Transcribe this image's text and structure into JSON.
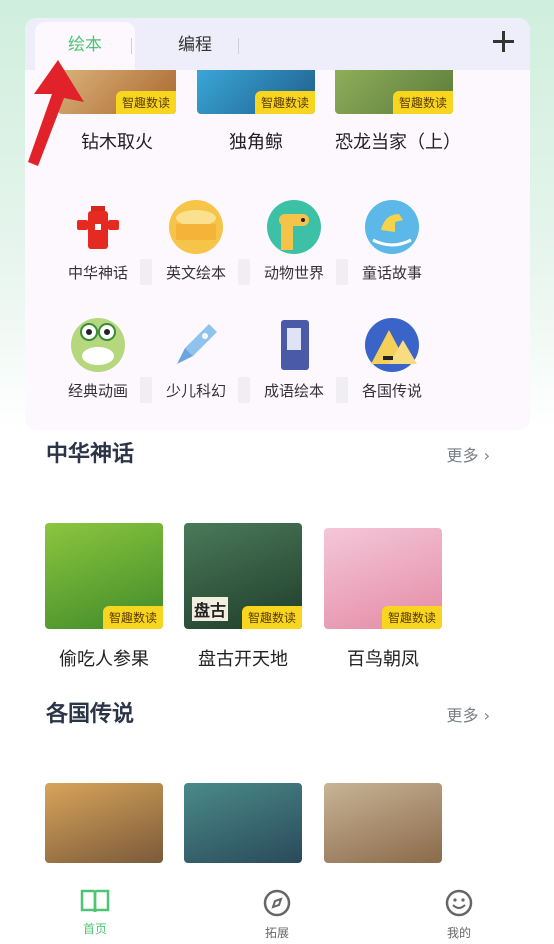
{
  "tabs": [
    {
      "label": "绘本",
      "active": true
    },
    {
      "label": "编程",
      "active": false
    }
  ],
  "featured_top": [
    {
      "title": "钻木取火",
      "badge": "智趣数读"
    },
    {
      "title": "独角鲸",
      "badge": "智趣数读"
    },
    {
      "title": "恐龙当家（上）",
      "badge": "智趣数读"
    }
  ],
  "categories": [
    {
      "label": "中华神话",
      "icon": "fire-hydrant-icon"
    },
    {
      "label": "英文绘本",
      "icon": "lantern-icon"
    },
    {
      "label": "动物世界",
      "icon": "giraffe-icon"
    },
    {
      "label": "童话故事",
      "icon": "rocking-horse-icon"
    },
    {
      "label": "经典动画",
      "icon": "frog-icon"
    },
    {
      "label": "少儿科幻",
      "icon": "rocket-icon"
    },
    {
      "label": "成语绘本",
      "icon": "book-icon"
    },
    {
      "label": "各国传说",
      "icon": "pyramid-icon"
    }
  ],
  "sections": [
    {
      "title": "中华神话",
      "more": "更多 ›",
      "books": [
        {
          "title": "偷吃人参果",
          "badge": "智趣数读"
        },
        {
          "title": "盘古开天地",
          "badge": "智趣数读",
          "cover_text": "盘古"
        },
        {
          "title": "百鸟朝凤",
          "badge": "智趣数读"
        }
      ]
    },
    {
      "title": "各国传说",
      "more": "更多 ›",
      "books": [
        {
          "title": ""
        },
        {
          "title": ""
        },
        {
          "title": ""
        }
      ]
    }
  ],
  "nav": [
    {
      "label": "首页",
      "icon": "book-open-icon",
      "active": true
    },
    {
      "label": "拓展",
      "icon": "compass-icon",
      "active": false
    },
    {
      "label": "我的",
      "icon": "smiley-icon",
      "active": false
    }
  ],
  "colors": {
    "accent": "#4fc574",
    "badge": "#f8d51e",
    "title": "#2c3548"
  }
}
